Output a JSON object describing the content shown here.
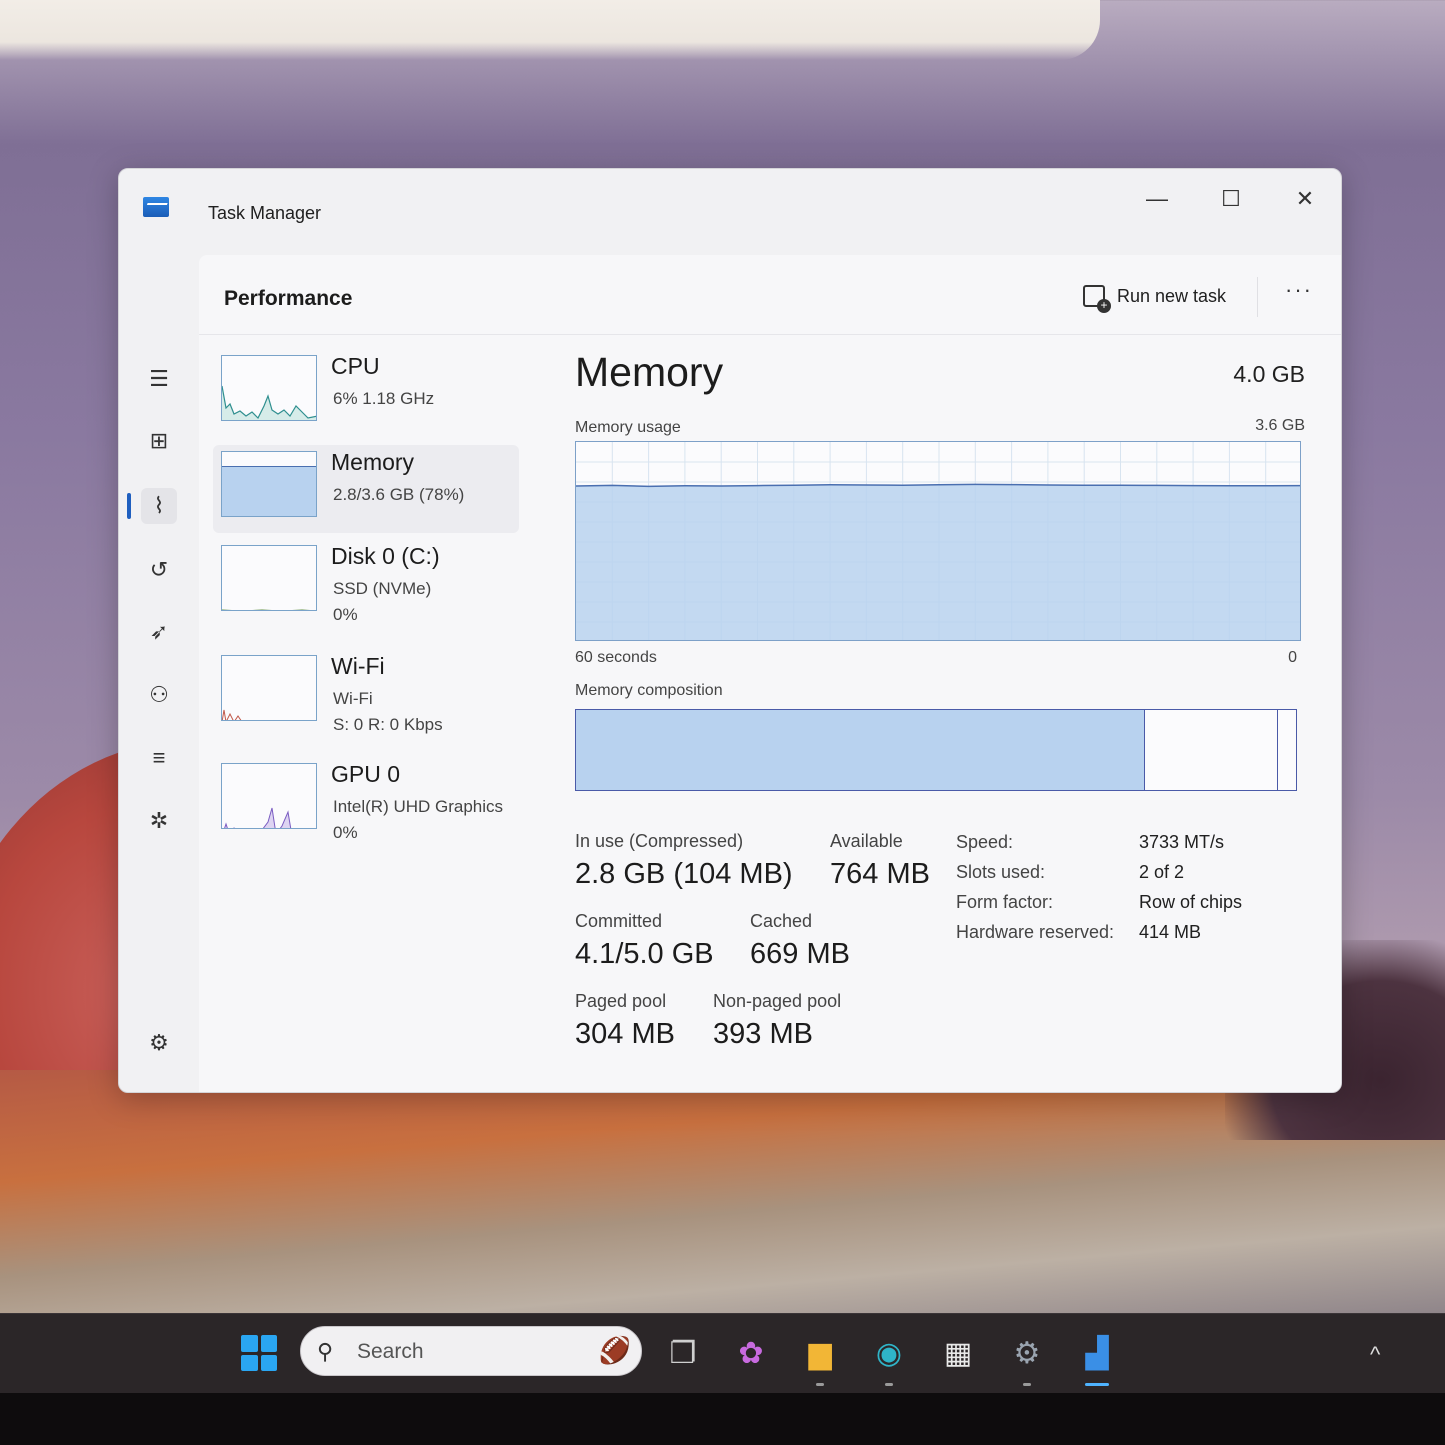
{
  "window": {
    "title": "Task Manager",
    "minimize_glyph": "—",
    "maximize_glyph": "☐",
    "close_glyph": "✕"
  },
  "header": {
    "page_title": "Performance",
    "run_new_task": "Run new task",
    "more_glyph": "···"
  },
  "sidebar": {
    "items": [
      {
        "icon": "hamburger-menu-icon",
        "glyph": "☰"
      },
      {
        "icon": "processes-icon",
        "glyph": "⊞"
      },
      {
        "icon": "performance-icon",
        "glyph": "⌇",
        "active": true
      },
      {
        "icon": "app-history-icon",
        "glyph": "↺"
      },
      {
        "icon": "startup-apps-icon",
        "glyph": "➶"
      },
      {
        "icon": "users-icon",
        "glyph": "⚇"
      },
      {
        "icon": "details-icon",
        "glyph": "≡"
      },
      {
        "icon": "services-icon",
        "glyph": "✲"
      }
    ],
    "settings_glyph": "⚙"
  },
  "devices": [
    {
      "name": "CPU",
      "sub1": "6%  1.18 GHz",
      "sub2": ""
    },
    {
      "name": "Memory",
      "sub1": "2.8/3.6 GB (78%)",
      "sub2": "",
      "active": true
    },
    {
      "name": "Disk 0 (C:)",
      "sub1": "SSD (NVMe)",
      "sub2": "0%"
    },
    {
      "name": "Wi-Fi",
      "sub1": "Wi-Fi",
      "sub2": "S: 0  R: 0 Kbps"
    },
    {
      "name": "GPU 0",
      "sub1": "Intel(R) UHD Graphics",
      "sub2": "0%"
    }
  ],
  "memory": {
    "title": "Memory",
    "total": "4.0 GB",
    "usage_label": "Memory usage",
    "usage_max": "3.6 GB",
    "time_left": "60 seconds",
    "time_right": "0",
    "composition_label": "Memory composition",
    "usage_fraction": 0.78,
    "composition": {
      "in_use": 0.79,
      "standby": 0.185,
      "free": 0.025
    },
    "stats": {
      "in_use_label": "In use (Compressed)",
      "in_use_value": "2.8 GB (104 MB)",
      "available_label": "Available",
      "available_value": "764 MB",
      "committed_label": "Committed",
      "committed_value": "4.1/5.0 GB",
      "cached_label": "Cached",
      "cached_value": "669 MB",
      "paged_label": "Paged pool",
      "paged_value": "304 MB",
      "nonpaged_label": "Non-paged pool",
      "nonpaged_value": "393 MB"
    },
    "specs": [
      {
        "key": "Speed:",
        "value": "3733 MT/s"
      },
      {
        "key": "Slots used:",
        "value": "2 of 2"
      },
      {
        "key": "Form factor:",
        "value": "Row of chips"
      },
      {
        "key": "Hardware reserved:",
        "value": "414 MB"
      }
    ]
  },
  "taskbar": {
    "search_placeholder": "Search",
    "search_glyph": "⚲",
    "tray_chevron": "^",
    "apps": [
      {
        "icon": "task-view-icon",
        "glyph": "❐"
      },
      {
        "icon": "copilot-icon",
        "glyph": "✿"
      },
      {
        "icon": "file-explorer-icon",
        "glyph": "▆"
      },
      {
        "icon": "edge-icon",
        "glyph": "◉"
      },
      {
        "icon": "store-icon",
        "glyph": "▦"
      },
      {
        "icon": "settings-app-icon",
        "glyph": "⚙"
      },
      {
        "icon": "task-manager-app-icon",
        "glyph": "▟",
        "active": true
      }
    ]
  },
  "colors": {
    "accent": "#1f5fbf",
    "memory_fill": "#b8d2ef",
    "memory_line": "#4a6fb0",
    "cpu_line": "#2f8f8f",
    "gpu_line": "#7a5cc2",
    "wifi_line": "#c0584a"
  }
}
